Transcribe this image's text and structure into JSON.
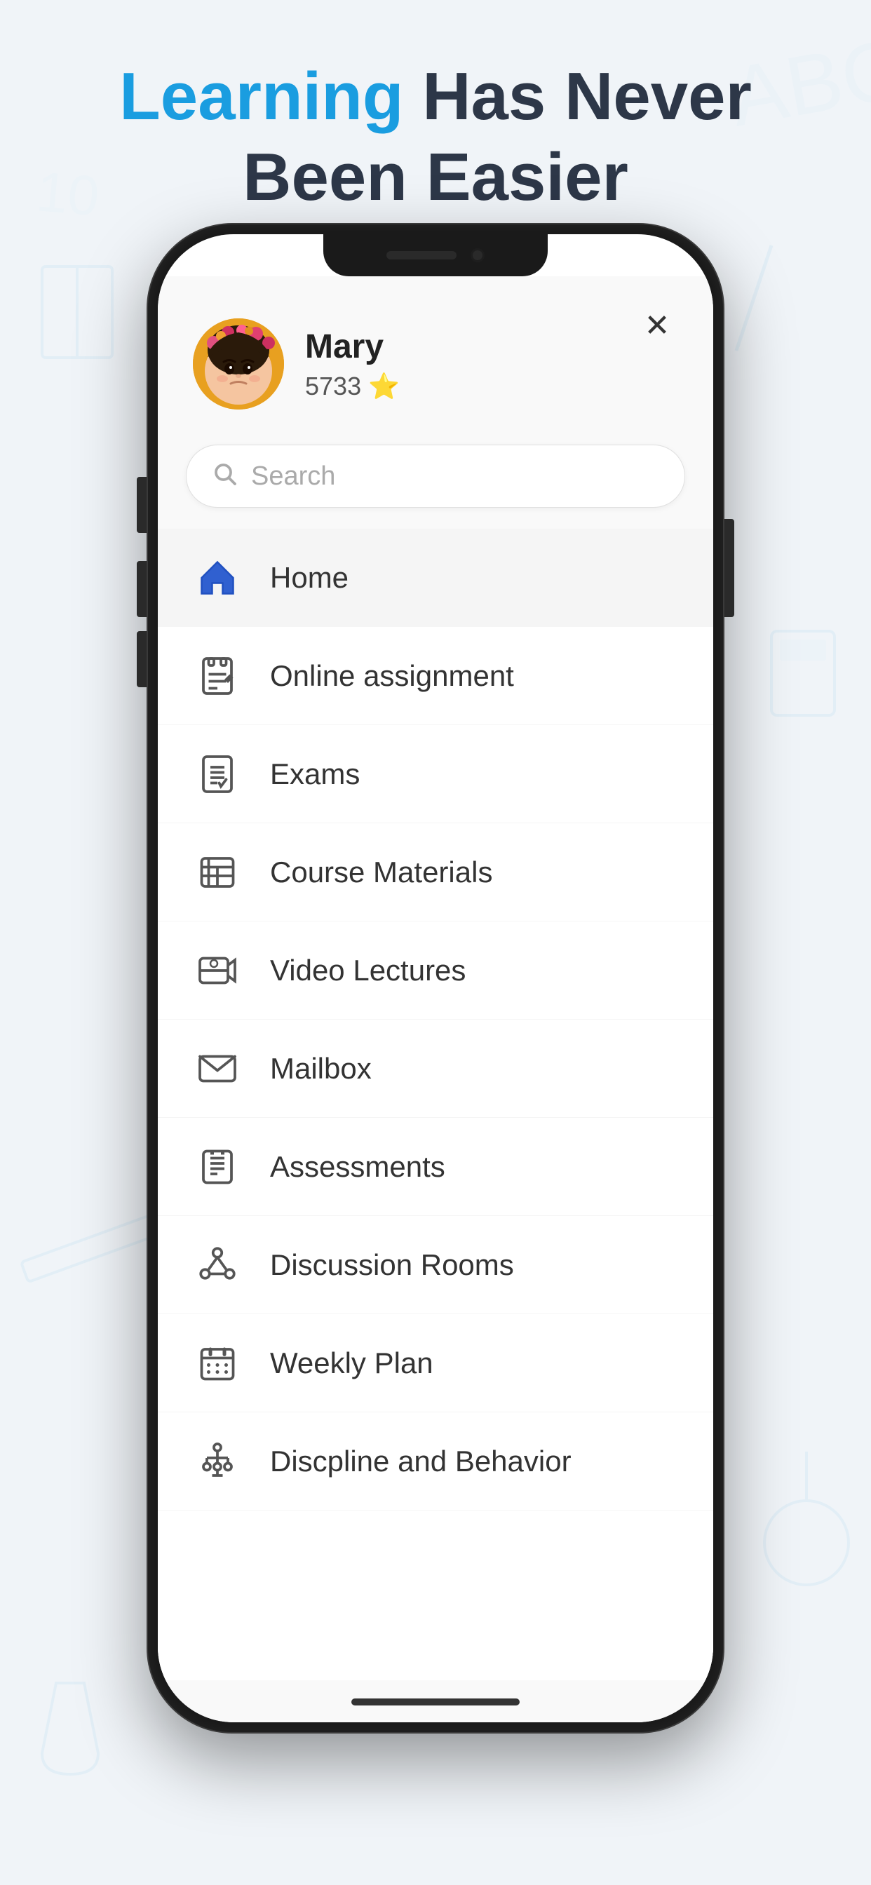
{
  "header": {
    "title_highlight": "Learning",
    "title_rest": " Has Never\nBeen Easier"
  },
  "profile": {
    "name": "Mary",
    "stars": "5733 ⭐",
    "star_emoji": "⭐"
  },
  "search": {
    "placeholder": "Search"
  },
  "menu": {
    "items": [
      {
        "id": "home",
        "label": "Home",
        "active": true,
        "icon": "home-icon"
      },
      {
        "id": "online-assignment",
        "label": "Online assignment",
        "active": false,
        "icon": "assignment-icon"
      },
      {
        "id": "exams",
        "label": "Exams",
        "active": false,
        "icon": "exam-icon"
      },
      {
        "id": "course-materials",
        "label": "Course Materials",
        "active": false,
        "icon": "materials-icon"
      },
      {
        "id": "video-lectures",
        "label": "Video Lectures",
        "active": false,
        "icon": "video-icon"
      },
      {
        "id": "mailbox",
        "label": "Mailbox",
        "active": false,
        "icon": "mail-icon"
      },
      {
        "id": "assessments",
        "label": "Assessments",
        "active": false,
        "icon": "assess-icon"
      },
      {
        "id": "discussion-rooms",
        "label": "Discussion Rooms",
        "active": false,
        "icon": "discuss-icon"
      },
      {
        "id": "weekly-plan",
        "label": "Weekly Plan",
        "active": false,
        "icon": "calendar-icon"
      },
      {
        "id": "discipline",
        "label": "Discpline and Behavior",
        "active": false,
        "icon": "discipline-icon"
      }
    ]
  },
  "colors": {
    "blue_accent": "#1a9de0",
    "dark_text": "#2d3748",
    "menu_active_bg": "#f5f5f5"
  }
}
